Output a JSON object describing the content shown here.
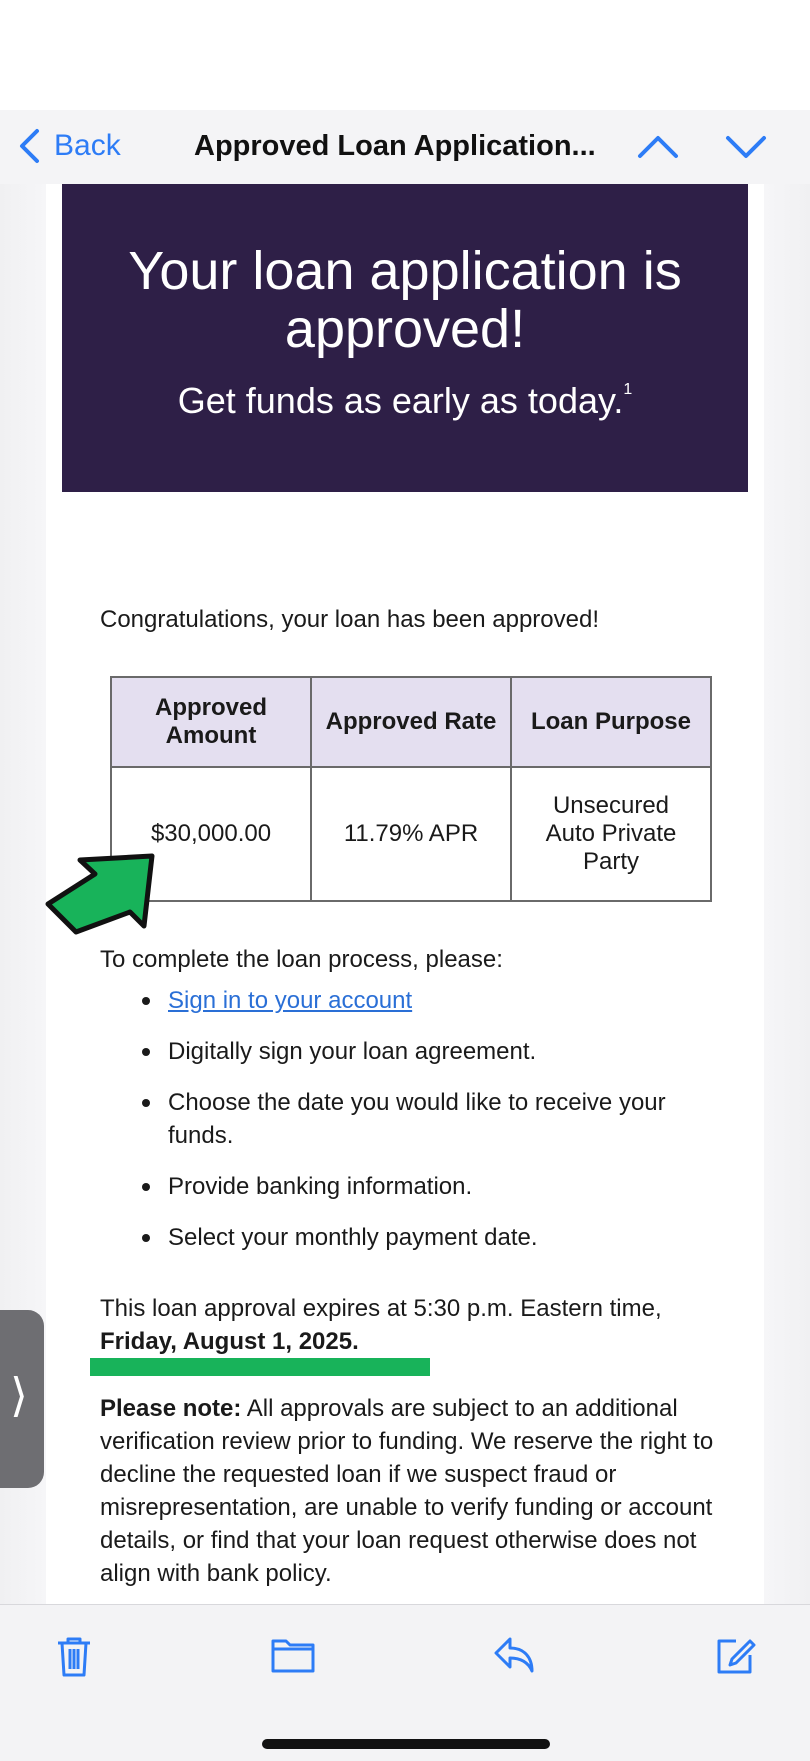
{
  "nav": {
    "back_label": "Back",
    "title": "Approved Loan Application..."
  },
  "hero": {
    "headline": "Your loan application is approved!",
    "subhead": "Get funds as early as today.",
    "footnote_mark": "1"
  },
  "body": {
    "congrats": "Congratulations, your loan has been approved!",
    "table": {
      "headers": [
        "Approved Amount",
        "Approved Rate",
        "Loan Purpose"
      ],
      "values": [
        "$30,000.00",
        "11.79% APR",
        "Unsecured Auto Private Party"
      ]
    },
    "steps_intro": "To complete the loan process, please:",
    "steps": [
      "Sign in to your account",
      "Digitally sign your loan agreement.",
      "Choose the date you would like to receive your funds.",
      "Provide banking information.",
      "Select your monthly payment date."
    ],
    "expires_text": "This loan approval expires at 5:30 p.m. Eastern time,",
    "expires_date": "Friday, August 1, 2025.",
    "note_label": "Please note:",
    "note_text": " All approvals are subject to an additional verification review prior to funding. We reserve the right to decline the requested loan if we suspect fraud or misrepresentation, are unable to verify funding or account details, or find that your loan request otherwise does not align with bank policy."
  },
  "colors": {
    "accent": "#2d7cf6",
    "hero_bg": "#2e1f47",
    "table_header_bg": "#e4dff0",
    "annotation_green": "#18b35a"
  },
  "toolbar": {
    "icons": [
      "trash-icon",
      "folder-icon",
      "reply-icon",
      "compose-icon"
    ]
  }
}
